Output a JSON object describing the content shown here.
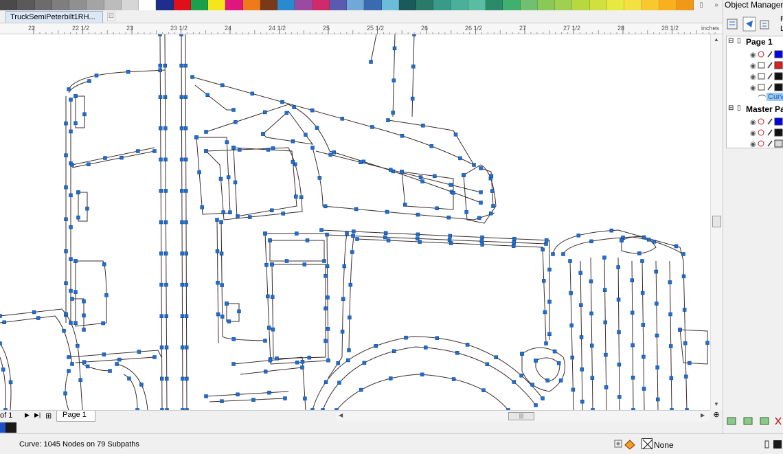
{
  "palette": [
    "#4a4a4a",
    "#5a5a5a",
    "#6c6c6c",
    "#7e7e7e",
    "#909090",
    "#a4a4a4",
    "#bcbcbc",
    "#d6d6d6",
    "#ffffff",
    "#1e2e8c",
    "#e0101a",
    "#1aa04a",
    "#f4e61a",
    "#e0157e",
    "#ef7a1a",
    "#7a3a1a",
    "#2a8ad0",
    "#9a4aa0",
    "#d02a6a",
    "#5a5ab0",
    "#70a8d8",
    "#3a6ab0",
    "#6abcd8",
    "#1a5a5a",
    "#2a7a6a",
    "#3a9a8a",
    "#4ab09a",
    "#5abca0",
    "#2a8a6a",
    "#40b070",
    "#70c070",
    "#8ac858",
    "#a0d050",
    "#b8d840",
    "#d0e040",
    "#e8e840",
    "#f4e040",
    "#f8c830",
    "#f8b020",
    "#f09818"
  ],
  "document": {
    "tab_name": "TruckSemiPeterbilt1RH...",
    "tab_close": "⊡"
  },
  "ruler": {
    "unit": "inches",
    "labels": [
      "22",
      "22 1/2",
      "23",
      "23 1/2",
      "24",
      "24 1/2",
      "25",
      "25 1/2",
      "26",
      "26 1/2",
      "27",
      "27 1/2",
      "28",
      "28 1/2"
    ]
  },
  "page_nav": {
    "of_label": "of 1",
    "page_tab": "Page 1"
  },
  "status": {
    "info": "Curve: 1045 Nodes on 79 Subpaths",
    "outline_label": "None"
  },
  "object_manager": {
    "title": "Object Manager",
    "page1": "Page 1",
    "curve_label": "Curve",
    "master_page": "Master Page",
    "panel_header_1": "P",
    "panel_header_2": "L",
    "layer_colors": [
      "#0000ee",
      "#e02020",
      "#111111",
      "#111111"
    ],
    "master_colors": [
      "#0000ee",
      "#111111",
      "#d8d8d8"
    ]
  },
  "doc_palette": [
    "#1e50c8",
    "#1a1a1a"
  ]
}
